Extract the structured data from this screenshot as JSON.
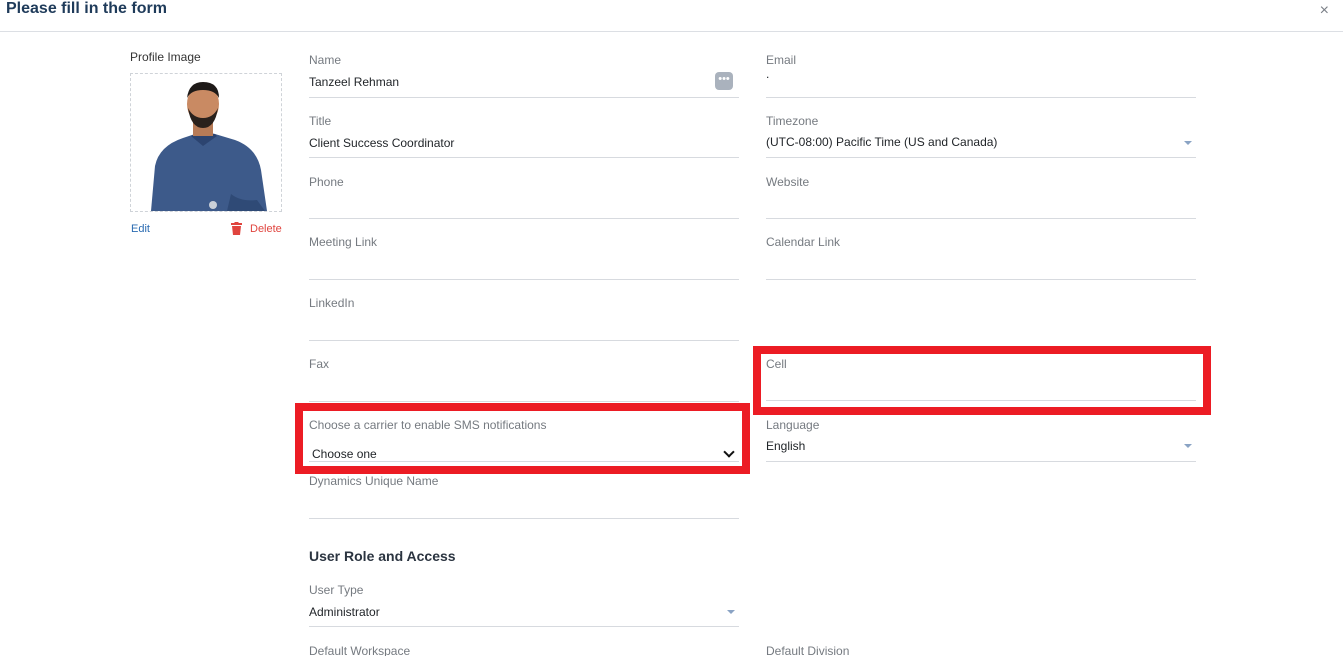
{
  "header": {
    "title": "Please fill in the form",
    "close_label": "×"
  },
  "profile": {
    "label": "Profile Image",
    "edit_label": "Edit",
    "delete_label": "Delete"
  },
  "fields": {
    "name": {
      "label": "Name",
      "value": "Tanzeel Rehman",
      "more_label": "•••"
    },
    "email": {
      "label": "Email",
      "value": "."
    },
    "title": {
      "label": "Title",
      "value": "Client Success Coordinator"
    },
    "timezone": {
      "label": "Timezone",
      "value": "(UTC-08:00) Pacific Time (US and Canada)"
    },
    "phone": {
      "label": "Phone",
      "value": ""
    },
    "website": {
      "label": "Website",
      "value": ""
    },
    "meeting_link": {
      "label": "Meeting Link",
      "value": ""
    },
    "calendar_link": {
      "label": "Calendar Link",
      "value": ""
    },
    "linkedin": {
      "label": "LinkedIn",
      "value": ""
    },
    "fax": {
      "label": "Fax",
      "value": ""
    },
    "cell": {
      "label": "Cell",
      "value": ""
    },
    "carrier": {
      "label": "Choose a carrier to enable SMS notifications",
      "value": "Choose one"
    },
    "language": {
      "label": "Language",
      "value": "English"
    },
    "dynamics_name": {
      "label": "Dynamics Unique Name",
      "value": ""
    },
    "user_type": {
      "label": "User Type",
      "value": "Administrator"
    },
    "default_workspace": {
      "label": "Default Workspace",
      "value": ""
    },
    "default_division": {
      "label": "Default Division",
      "value": ""
    }
  },
  "sections": {
    "role_access": "User Role and Access"
  },
  "colors": {
    "highlight": "#ec1c24",
    "link": "#2a6bb1",
    "danger": "#e0443e",
    "title": "#1f3b5a"
  }
}
